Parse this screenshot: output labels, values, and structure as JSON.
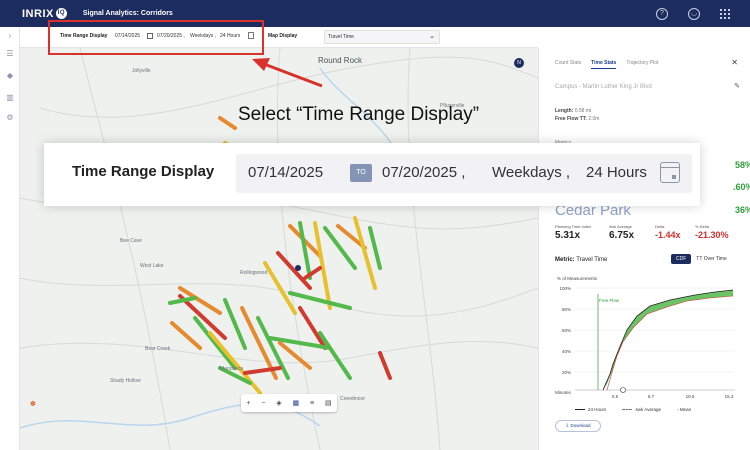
{
  "header": {
    "logo": "INRIX",
    "logo_badge": "IQ",
    "title": "Signal Analytics: Corridors",
    "icons": [
      "help-icon",
      "user-icon",
      "app-grid-icon"
    ]
  },
  "filter_bar": {
    "time_range_label": "Time Range Display",
    "start_date": "07/14/2025",
    "end_date": "07/20/2025 ,",
    "days": "Weekdays ,",
    "hours": "24 Hours",
    "map_display_label": "Map Display",
    "map_display_value": "Travel Time"
  },
  "map": {
    "labels": {
      "round_rock": "Round Rock",
      "bee_cave": "Bee Cave",
      "rollingwood": "Rollingwood",
      "manchaca": "Manchaca",
      "west_lake": "West Lake",
      "jollyville": "Jollyville",
      "pflugerville": "Pflugerville",
      "bear_creek": "Bear Creek",
      "shady_hollow": "Shady Hollow",
      "creedmoor": "Creedmoor"
    },
    "toolbar_icons": [
      "zoom-in-icon",
      "zoom-out-icon",
      "layers-icon",
      "map-view-icon",
      "list-view-icon",
      "grid-view-icon"
    ]
  },
  "panel": {
    "tabs": [
      "Count Stats",
      "Time Stats",
      "Trajectory Plot"
    ],
    "active_tab": "Time Stats",
    "corridor_name": "Campus - Martin Luther King Jr Blvd",
    "length_label": "Length:",
    "length_value": "0.58 mi",
    "free_flow_label": "Free Flow TT:",
    "free_flow_value": "2.0m",
    "metrics_label": "Metrics",
    "city_watermark": "Cedar Park",
    "stats": [
      {
        "label": "Planning Time Index",
        "value": "5.31x"
      },
      {
        "label": "4wk Average",
        "value": "6.75x"
      },
      {
        "label": "Delta",
        "value": "-1.44x"
      },
      {
        "label": "% Delta",
        "value": "-21.30%"
      }
    ],
    "side_percents": [
      "58%",
      ".60%",
      "36%"
    ],
    "metric_label": "Metric:",
    "metric_value": "Travel Time",
    "toggle_on": "CDF",
    "toggle_off": "TT Over Time",
    "chart_y_title": "% of Measurements",
    "chart_y_ticks": [
      "100%",
      "80%",
      "60%",
      "40%",
      "20%",
      "0%"
    ],
    "chart_x_title": "Minutes",
    "chart_x_ticks": [
      "0.5",
      "6.7",
      "10.5",
      "15.3"
    ],
    "free_flow_marker": "Free Flow",
    "legend": [
      "24 Hours",
      "4wk Average",
      "Mean"
    ],
    "download_label": "Download"
  },
  "callout": {
    "title": "Select “Time Range Display”",
    "label": "Time Range Display",
    "start_date": "07/14/2025",
    "to_label": "TO",
    "end_date": "07/20/2025 ,",
    "days": "Weekdays ,",
    "hours": "24 Hours"
  },
  "colors": {
    "header": "#1d2c5e",
    "highlight": "#d9312b",
    "green": "#2e9d3a",
    "red": "#cf2f2f",
    "road_green": "#52b94a",
    "road_yellow": "#e6c12d",
    "road_orange": "#e58a2f",
    "road_red": "#d13b2f"
  }
}
